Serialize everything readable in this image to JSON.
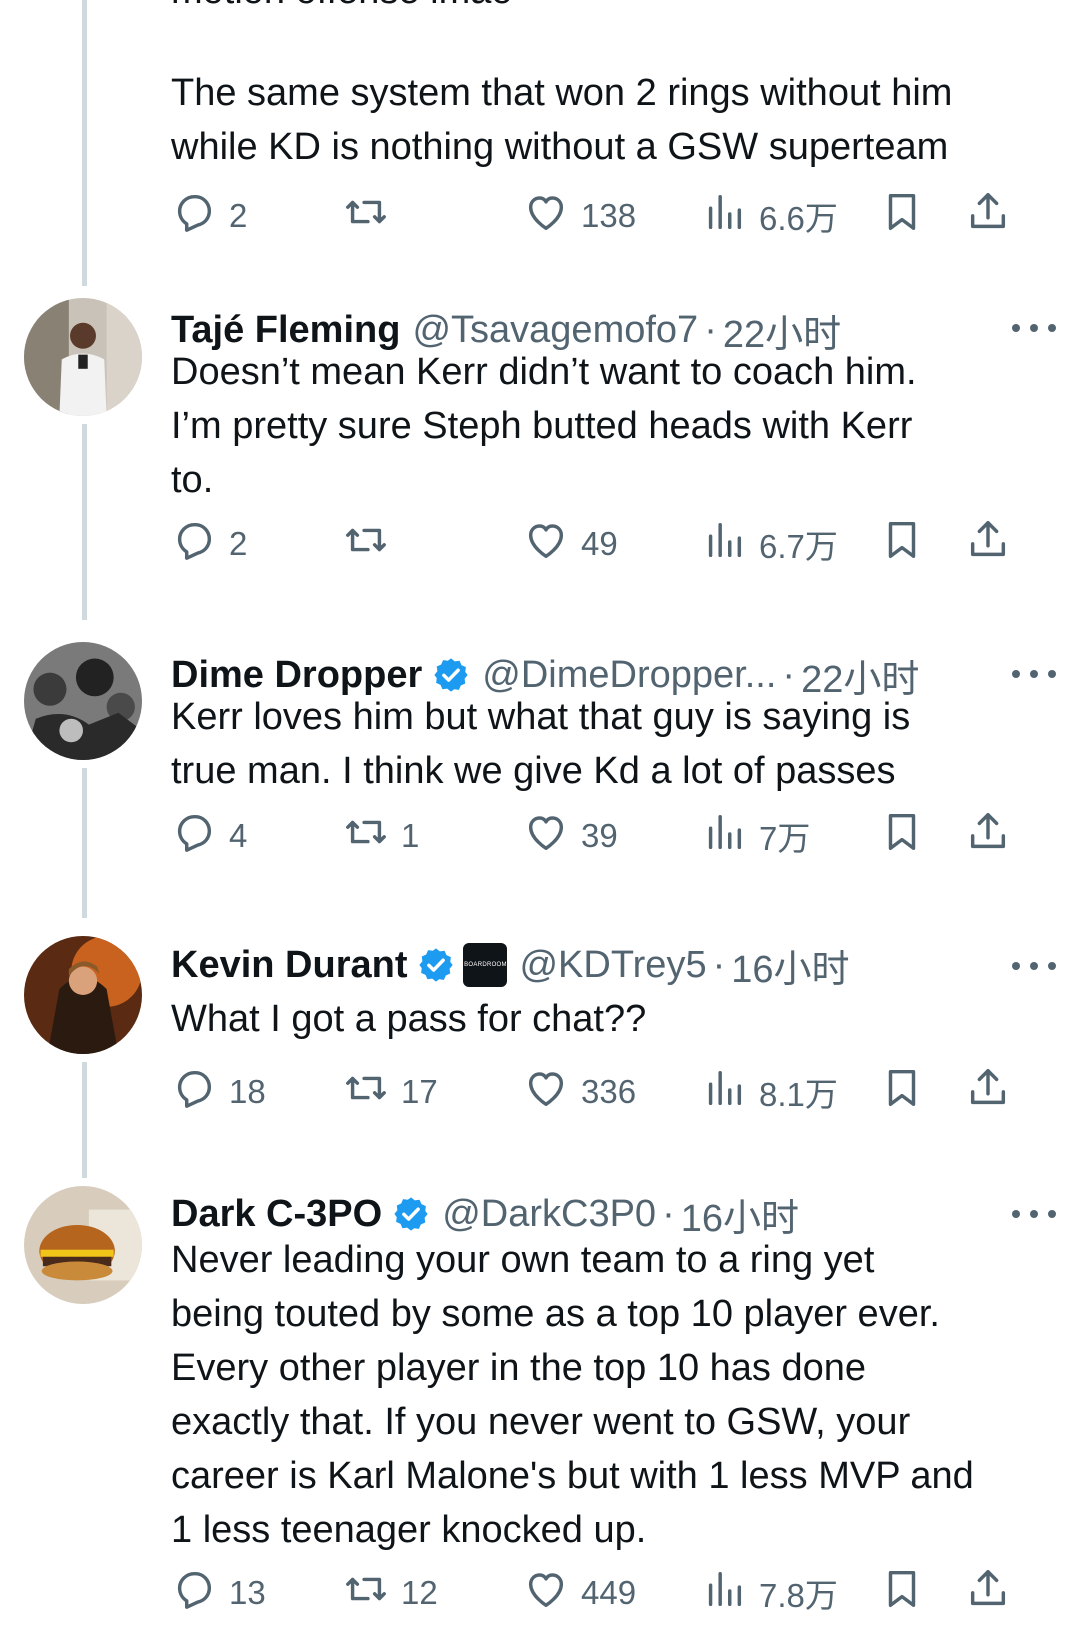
{
  "partial_top_text": "motion offense lmao",
  "first_tweet": {
    "text": "The same system that won 2 rings without him\nwhile KD is nothing without a GSW superteam",
    "replies": "2",
    "retweets": "",
    "likes": "138",
    "views": "6.6万"
  },
  "tweets": [
    {
      "name": "Tajé Fleming",
      "handle": "@Tsavagemofo7",
      "time": "22小时",
      "verified": false,
      "text": "Doesn’t mean Kerr didn’t want to coach him.\nI’m pretty sure Steph butted heads with Kerr\nto.",
      "replies": "2",
      "retweets": "",
      "likes": "49",
      "views": "6.7万"
    },
    {
      "name": "Dime Dropper",
      "handle": "@DimeDropper...",
      "time": "22小时",
      "verified": true,
      "text": "Kerr loves him but what that guy is saying is\ntrue man. I think we give Kd a lot of passes",
      "replies": "4",
      "retweets": "1",
      "likes": "39",
      "views": "7万"
    },
    {
      "name": "Kevin Durant",
      "handle": "@KDTrey5",
      "time": "16小时",
      "verified": true,
      "affiliate_label": "BOARDROOM",
      "text": "What I got a pass for chat??",
      "replies": "18",
      "retweets": "17",
      "likes": "336",
      "views": "8.1万"
    },
    {
      "name": "Dark C-3PO",
      "handle": "@DarkC3P0",
      "time": "16小时",
      "verified": true,
      "text": "Never leading your own team to a ring yet\nbeing touted by some as a top 10 player ever.\nEvery other player in the top 10 has done\nexactly that. If you never went to GSW, your\ncareer is Karl Malone's but with 1 less MVP and\n1 less teenager knocked up.",
      "replies": "13",
      "retweets": "12",
      "likes": "449",
      "views": "7.8万"
    }
  ],
  "colors": {
    "text": "#0f1419",
    "secondary": "#536471",
    "verified": "#1d9bf0",
    "thread_line": "#cfd9de"
  },
  "icons": [
    "reply-icon",
    "retweet-icon",
    "like-icon",
    "views-icon",
    "bookmark-icon",
    "share-icon",
    "verified-badge-icon",
    "more-icon"
  ]
}
